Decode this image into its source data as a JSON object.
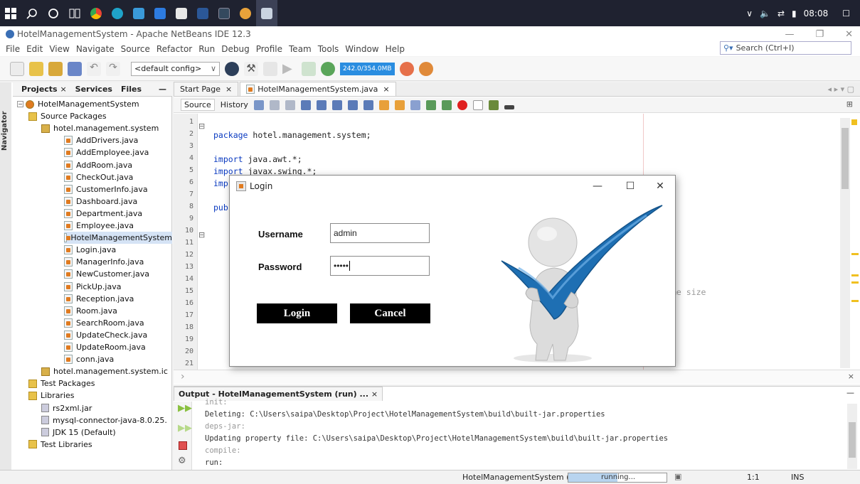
{
  "taskbar": {
    "icons": [
      "windows-start-icon",
      "search-icon",
      "cortana-icon",
      "task-view-icon",
      "chrome-icon",
      "edge-icon",
      "file-explorer-icon",
      "mail-icon",
      "store-icon",
      "word-icon",
      "terminal-icon",
      "netbeans-icon",
      "java-icon"
    ],
    "time": "08:08"
  },
  "window": {
    "title": "HotelManagementSystem - Apache NetBeans IDE 12.3"
  },
  "menu": [
    "File",
    "Edit",
    "View",
    "Navigate",
    "Source",
    "Refactor",
    "Run",
    "Debug",
    "Profile",
    "Team",
    "Tools",
    "Window",
    "Help"
  ],
  "search": {
    "placeholder": "Search (Ctrl+I)"
  },
  "toolbar": {
    "config": "<default config>",
    "memory": "242.0/354.0MB"
  },
  "projects": {
    "tabs": [
      "Projects",
      "Services",
      "Files"
    ],
    "navigator_label": "Navigator",
    "root": "HotelManagementSystem",
    "source_packages": "Source Packages",
    "package": "hotel.management.system",
    "files": [
      "AddDrivers.java",
      "AddEmployee.java",
      "AddRoom.java",
      "CheckOut.java",
      "CustomerInfo.java",
      "Dashboard.java",
      "Department.java",
      "Employee.java",
      "HotelManagementSystem",
      "Login.java",
      "ManagerInfo.java",
      "NewCustomer.java",
      "PickUp.java",
      "Reception.java",
      "Room.java",
      "SearchRoom.java",
      "UpdateCheck.java",
      "UpdateRoom.java",
      "conn.java"
    ],
    "package2": "hotel.management.system.ic",
    "test_packages": "Test Packages",
    "libraries": "Libraries",
    "libs": [
      "rs2xml.jar",
      "mysql-connector-java-8.0.25.",
      "JDK 15 (Default)"
    ],
    "test_libraries": "Test Libraries"
  },
  "editor": {
    "tabs": [
      "Start Page",
      "HotelManagementSystem.java"
    ],
    "source_label": "Source",
    "history_label": "History",
    "line_numbers": [
      "1",
      "2",
      "3",
      "4",
      "5",
      "6",
      "7",
      "8",
      "9",
      "10",
      "11",
      "12",
      "13",
      "14",
      "15",
      "16",
      "17",
      "18",
      "19",
      "20",
      "21"
    ],
    "code": {
      "l2_kw": "package",
      "l2": " hotel.management.system;",
      "l4_kw": "import",
      "l4": " java.awt.*;",
      "l5_kw": "import",
      "l5": " javax.swing.*;",
      "l6_kw": "imp",
      "l8_kw": "pub",
      "l15": "me size"
    }
  },
  "output": {
    "tab": "Output - HotelManagementSystem (run) ...",
    "lines": [
      "init:",
      "Deleting: C:\\Users\\saipa\\Desktop\\Project\\HotelManagementSystem\\build\\built-jar.properties",
      "deps-jar:",
      "Updating property file: C:\\Users\\saipa\\Desktop\\Project\\HotelManagementSystem\\build\\built-jar.properties",
      "compile:",
      "run:"
    ]
  },
  "status": {
    "project": "HotelManagementSystem (run)",
    "progress_text": "running...",
    "progress_fraction": 0.5,
    "position": "1:1",
    "mode": "INS"
  },
  "login": {
    "title": "Login",
    "username_label": "Username",
    "username_value": "admin",
    "password_label": "Password",
    "password_value": "•••••",
    "login_button": "Login",
    "cancel_button": "Cancel"
  },
  "colors": {
    "accent": "#2a8de0",
    "checkmark": "#1e6fb3",
    "button_bg": "#000000"
  }
}
